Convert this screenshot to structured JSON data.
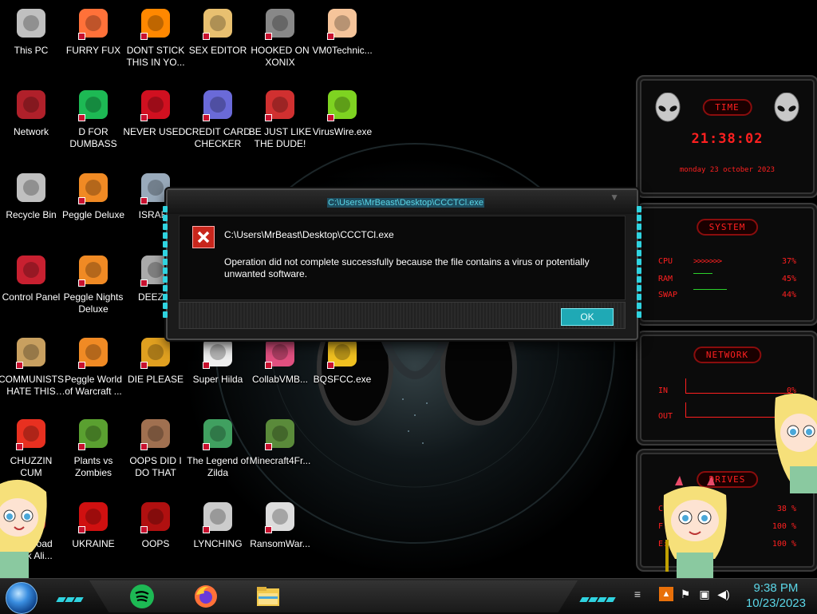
{
  "desktop": {
    "icons": [
      {
        "label": "This PC",
        "icon": "computer-icon"
      },
      {
        "label": "FURRY FUX",
        "icon": "firefox-icon"
      },
      {
        "label": "DONT STICK THIS IN YO...",
        "icon": "vlc-cone-icon"
      },
      {
        "label": "SEX EDITOR",
        "icon": "hxd-icon"
      },
      {
        "label": "HOOKED ON XONIX",
        "icon": "xonix-icon"
      },
      {
        "label": "VM0Technic...",
        "icon": "doctor-icon"
      },
      {
        "label": "Network",
        "icon": "alien-network-icon"
      },
      {
        "label": "D FOR DUMBASS",
        "icon": "spotify-icon"
      },
      {
        "label": "NEVER USED!",
        "icon": "devcpp-icon"
      },
      {
        "label": "CREDIT CARD CHECKER",
        "icon": "credit-card-icon"
      },
      {
        "label": "BE JUST LIKE THE DUDE!",
        "icon": "santa-elf-icon"
      },
      {
        "label": "VirusWire.exe",
        "icon": "lime-icon"
      },
      {
        "label": "Recycle Bin",
        "icon": "recycle-bin-icon"
      },
      {
        "label": "Peggle Deluxe",
        "icon": "peggle-icon"
      },
      {
        "label": "ISRAEL",
        "icon": "satellite-icon"
      },
      {
        "label": "Control Panel",
        "icon": "control-panel-icon"
      },
      {
        "label": "Peggle Nights Deluxe",
        "icon": "peggle-icon"
      },
      {
        "label": "DEEZ N",
        "icon": "windows-stack-icon"
      },
      {
        "label": "COMMUNISTS HATE THIS G...",
        "icon": "money-bag-icon"
      },
      {
        "label": "Peggle World of Warcraft ...",
        "icon": "peggle-icon"
      },
      {
        "label": "DIE PLEASE",
        "icon": "dfsee-icon"
      },
      {
        "label": "Super Hilda",
        "icon": "hilda-icon"
      },
      {
        "label": "CollabVMB...",
        "icon": "collabvm-icon"
      },
      {
        "label": "BQSFCC.exe",
        "icon": "box-icon"
      },
      {
        "label": "CHUZZIN CUM",
        "icon": "chuzzle-icon"
      },
      {
        "label": "Plants vs Zombies",
        "icon": "plants-icon"
      },
      {
        "label": "OOPS DID I DO THAT",
        "icon": "portrait-icon"
      },
      {
        "label": "The Legend of Zilda",
        "icon": "zelda-icon"
      },
      {
        "label": "Minecraft4Fr...",
        "icon": "minecraft-icon"
      },
      {
        "label": "Download Hack Ali...",
        "icon": "alien-icon"
      },
      {
        "label": "UKRAINE",
        "icon": "radiation-icon"
      },
      {
        "label": "OOPS",
        "icon": "oops-icon"
      },
      {
        "label": "LYNCHING",
        "icon": "lynching-icon"
      },
      {
        "label": "RansomWar...",
        "icon": "skull-icon"
      }
    ]
  },
  "rainmeter": {
    "time": {
      "title": "TIME",
      "clock": "21:38:02",
      "date": "monday 23 october 2023"
    },
    "system": {
      "title": "SYSTEM",
      "rows": [
        {
          "label": "CPU",
          "value": "37%"
        },
        {
          "label": "RAM",
          "value": "45%"
        },
        {
          "label": "SWAP",
          "value": "44%"
        }
      ]
    },
    "network": {
      "title": "NETWORK",
      "rows": [
        {
          "label": "IN",
          "value": "0%"
        },
        {
          "label": "OUT",
          "value": ""
        }
      ]
    },
    "drives": {
      "title": "DRIVES",
      "rows": [
        {
          "label": "C:",
          "value": "38 %"
        },
        {
          "label": "F:",
          "value": "100 %"
        },
        {
          "label": "E:",
          "value": "100 %"
        }
      ]
    }
  },
  "dialog": {
    "title": "C:\\Users\\MrBeast\\Desktop\\CCCTCl.exe",
    "path": "C:\\Users\\MrBeast\\Desktop\\CCCTCl.exe",
    "message": "Operation did not complete successfully because the file contains a virus or potentially unwanted software.",
    "ok_label": "OK"
  },
  "taskbar": {
    "apps": [
      {
        "icon": "spotify-icon"
      },
      {
        "icon": "firefox-icon"
      },
      {
        "icon": "file-explorer-icon"
      }
    ],
    "tray": [
      {
        "icon": "fire-icon"
      },
      {
        "icon": "flag-icon"
      },
      {
        "icon": "network-icon"
      },
      {
        "icon": "speaker-icon"
      }
    ],
    "time": "9:38 PM",
    "date": "10/23/2023"
  },
  "colors": {
    "accent_cyan": "#2fd3e0",
    "rainmeter_red": "#ff2020",
    "dialog_ok": "#1fa9b5"
  }
}
